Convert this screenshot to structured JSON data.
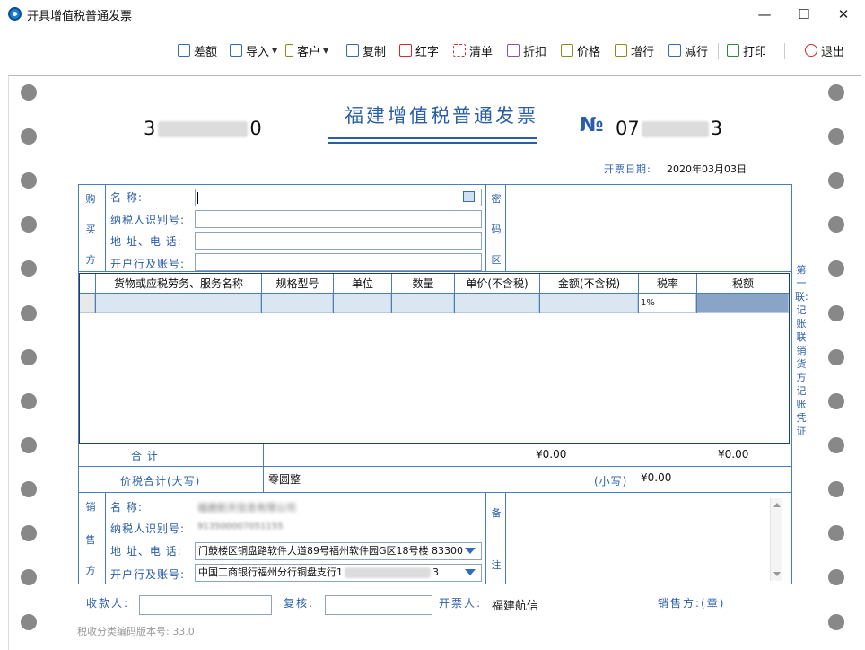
{
  "window": {
    "title": "开具增值税普通发票",
    "minimize": "—",
    "maximize": "☐",
    "close": "✕"
  },
  "toolbar": {
    "items": [
      {
        "label": "差额",
        "icon": "table-icon"
      },
      {
        "label": "导入",
        "icon": "import-icon"
      },
      {
        "label": "客户",
        "icon": "customer-icon"
      },
      {
        "label": "复制",
        "icon": "copy-icon"
      },
      {
        "label": "红字",
        "icon": "red-invoice-icon"
      },
      {
        "label": "清单",
        "icon": "list-icon"
      },
      {
        "label": "折扣",
        "icon": "discount-icon"
      },
      {
        "label": "价格",
        "icon": "price-icon"
      },
      {
        "label": "增行",
        "icon": "add-row-icon"
      },
      {
        "label": "减行",
        "icon": "remove-row-icon"
      },
      {
        "label": "打印",
        "icon": "print-icon"
      },
      {
        "label": "退出",
        "icon": "power-icon"
      }
    ]
  },
  "invoice": {
    "title": "福建增值税普通发票",
    "code_prefix": "3",
    "code_suffix": "0",
    "no_mark": "№",
    "number_prefix": "07",
    "number_suffix": "3",
    "date_label": "开票日期:",
    "date_value": "2020年03月03日"
  },
  "buyer": {
    "section_chars": [
      "购",
      "买",
      "方"
    ],
    "name_label": "名        称:",
    "tax_id_label": "纳税人识别号:",
    "address_label": "地  址、电  话:",
    "bank_label": "开户行及账号:",
    "name_value": "",
    "tax_id_value": "",
    "address_value": "",
    "bank_value": ""
  },
  "cipher_area": {
    "chars": [
      "密",
      "码",
      "区"
    ]
  },
  "items_table": {
    "headers": [
      "货物或应税劳务、服务名称",
      "规格型号",
      "单位",
      "数量",
      "单价(不含税)",
      "金额(不含税)",
      "税率",
      "税额"
    ],
    "row": {
      "tax_rate": "1%"
    }
  },
  "totals": {
    "total_label": "合        计",
    "amount": "¥0.00",
    "tax": "¥0.00",
    "in_words_label": "价税合计(大写)",
    "in_words_value": "零圆整",
    "small_label": "(小写)",
    "small_value": "¥0.00"
  },
  "seller": {
    "section_chars": [
      "销",
      "售",
      "方"
    ],
    "name_label": "名        称:",
    "tax_id_label": "纳税人识别号:",
    "address_label": "地  址、电  话:",
    "bank_label": "开户行及账号:",
    "name_value": "福建航天信息有限公司",
    "tax_id_value": "913500007051155",
    "address_value": "门鼓楼区铜盘路软件大道89号福州软件园G区18号楼 83300",
    "bank_value": "中国工商银行福州分行铜盘支行1",
    "bank_value_suffix": "3"
  },
  "remarks": {
    "chars": [
      "备",
      "注"
    ]
  },
  "side_note": "第一联:记账联 销货方记账凭证",
  "footer": {
    "payee_label": "收款人:",
    "reviewer_label": "复核:",
    "issuer_label": "开票人:",
    "issuer_value": "福建航信",
    "seller_stamp": "销售方:(章)",
    "version_label": "税收分类编码版本号: 33.0"
  }
}
